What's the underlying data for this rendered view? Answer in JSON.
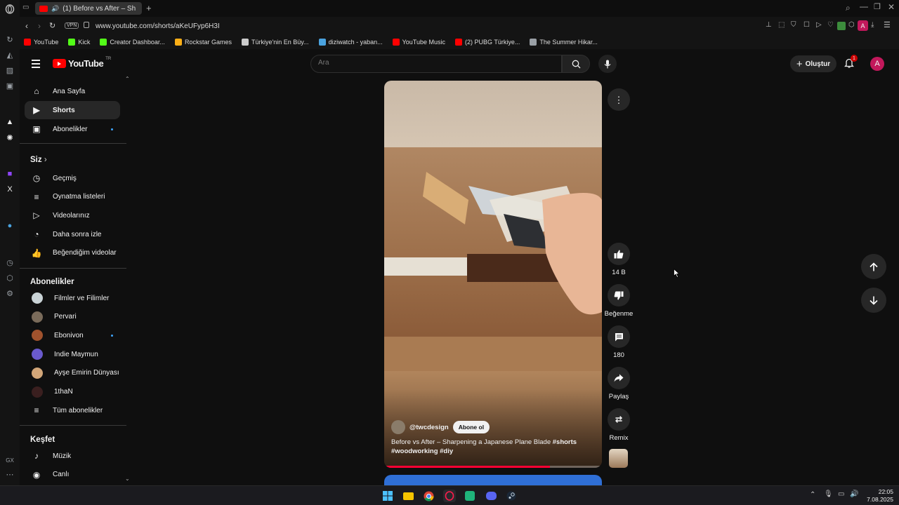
{
  "browser": {
    "tab_title": "(1) Before vs After – Sh",
    "url": "www.youtube.com/shorts/aKeUFyp6H3I",
    "vpn_label": "VPN",
    "profile_initial": "A",
    "bookmarks": [
      {
        "label": "YouTube",
        "color": "#ff0000"
      },
      {
        "label": "Kick",
        "color": "#53fc18"
      },
      {
        "label": "Creator Dashboar...",
        "color": "#53fc18"
      },
      {
        "label": "Rockstar Games",
        "color": "#fcaf17"
      },
      {
        "label": "Türkiye'nin En Büy...",
        "color": "#cccccc"
      },
      {
        "label": "diziwatch - yaban...",
        "color": "#4aa3df"
      },
      {
        "label": "YouTube Music",
        "color": "#ff0000"
      },
      {
        "label": "(2) PUBG Türkiye...",
        "color": "#ff0000"
      },
      {
        "label": "The Summer Hikar...",
        "color": "#9aa0a6"
      }
    ]
  },
  "masthead": {
    "logo_text": "YouTube",
    "logo_sup": "TR",
    "search_placeholder": "Ara",
    "create_label": "Oluştur",
    "notif_count": "1",
    "avatar_initial": "A"
  },
  "guide": {
    "main": [
      {
        "label": "Ana Sayfa",
        "icon": "home-icon"
      },
      {
        "label": "Shorts",
        "icon": "shorts-icon",
        "active": true
      },
      {
        "label": "Abonelikler",
        "icon": "subscriptions-icon",
        "dot": true
      }
    ],
    "you_heading": "Siz",
    "you": [
      {
        "label": "Geçmiş",
        "icon": "history-icon"
      },
      {
        "label": "Oynatma listeleri",
        "icon": "playlists-icon"
      },
      {
        "label": "Videolarınız",
        "icon": "your-videos-icon"
      },
      {
        "label": "Daha sonra izle",
        "icon": "watch-later-icon"
      },
      {
        "label": "Beğendiğim videolar",
        "icon": "liked-videos-icon"
      }
    ],
    "subs_heading": "Abonelikler",
    "subs": [
      {
        "label": "Filmler ve Filimler",
        "color": "#c9d3d6",
        "dot": true
      },
      {
        "label": "Pervari",
        "color": "#7a6b5a"
      },
      {
        "label": "Ebonivon",
        "color": "#a0522d",
        "dot": true
      },
      {
        "label": "Indie Maymun",
        "color": "#6a5acd"
      },
      {
        "label": "Ayşe Emirin Dünyası",
        "color": "#d2a679"
      },
      {
        "label": "1thaN",
        "color": "#3a1f1f"
      }
    ],
    "all_subs_label": "Tüm abonelikler",
    "explore_heading": "Keşfet",
    "explore": [
      {
        "label": "Müzik",
        "icon": "music-icon"
      },
      {
        "label": "Canlı",
        "icon": "live-icon"
      }
    ]
  },
  "short": {
    "channel": "@twcdesign",
    "subscribe_label": "Abone ol",
    "title_plain": "Before vs After – Sharpening a Japanese Plane Blade ",
    "title_bold1": "#shorts",
    "title_bold2": "#woodworking #diy",
    "progress": 0.76
  },
  "actions": {
    "likes": "14 B",
    "dislike_label": "Beğenme",
    "comments": "180",
    "share_label": "Paylaş",
    "remix_label": "Remix"
  },
  "taskbar": {
    "time": "22:05",
    "date": "7.08.2025"
  }
}
